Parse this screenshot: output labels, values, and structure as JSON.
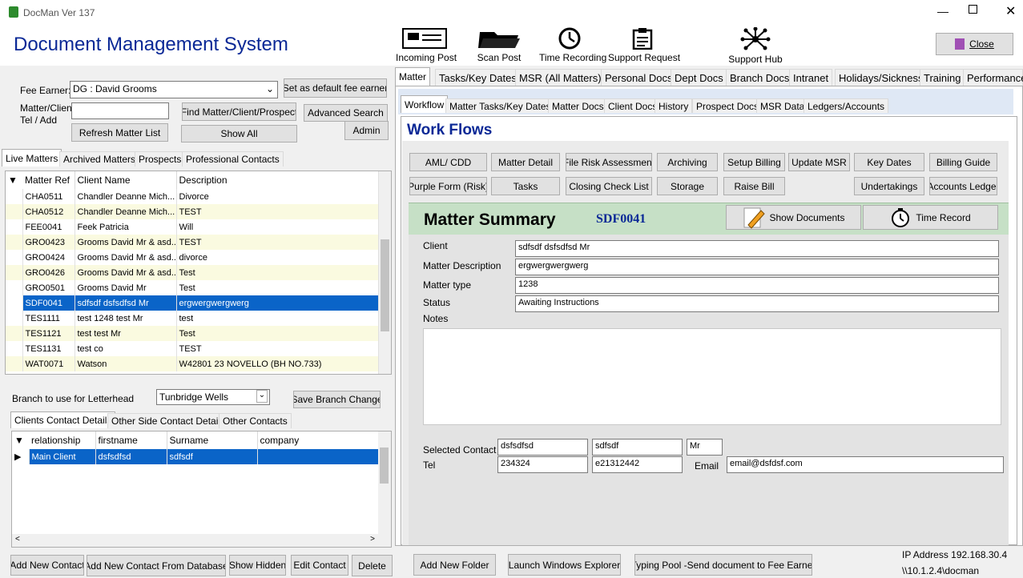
{
  "window": {
    "title": "DocMan Ver 137",
    "app_heading": "Document Management System",
    "close_label": "Close"
  },
  "toolbar": [
    {
      "label": "Incoming Post",
      "icon": "incoming-post-icon"
    },
    {
      "label": "Scan Post",
      "icon": "scan-post-icon"
    },
    {
      "label": "Time Recording",
      "icon": "clock-icon"
    },
    {
      "label": "Support Request",
      "icon": "clipboard-icon"
    },
    {
      "label": "Support Hub",
      "icon": "network-hub-icon"
    }
  ],
  "left": {
    "fee_earner_label": "Fee Earner:",
    "fee_earner_value": "DG : David Grooms",
    "set_default_label": "Set as default fee earner",
    "matter_client_label": "Matter/Client",
    "tel_add_label": "Tel / Add",
    "find_label": "Find Matter/Client/Prospect",
    "advanced_search_label": "Advanced Search",
    "refresh_label": "Refresh Matter List",
    "show_all_label": "Show All",
    "admin_label": "Admin",
    "tabs": [
      "Live Matters",
      "Archived Matters",
      "Prospects",
      "Professional Contacts"
    ],
    "columns": [
      "Matter Ref",
      "Client Name",
      "Description"
    ],
    "rows": [
      [
        "CHA0511",
        "Chandler Deanne Mich...",
        "Divorce"
      ],
      [
        "CHA0512",
        "Chandler Deanne Mich...",
        "TEST"
      ],
      [
        "FEE0041",
        "Feek Patricia",
        "Will"
      ],
      [
        "GRO0423",
        "Grooms David Mr & asd...",
        "TEST"
      ],
      [
        "GRO0424",
        "Grooms David Mr & asd...",
        "divorce"
      ],
      [
        "GRO0426",
        "Grooms David Mr & asd...",
        "Test"
      ],
      [
        "GRO0501",
        "Grooms David Mr",
        "Test"
      ],
      [
        "SDF0041",
        "sdfsdf dsfsdfsd  Mr",
        "ergwergwergwerg"
      ],
      [
        "TES1111",
        "test 1248 test  Mr",
        "test"
      ],
      [
        "TES1121",
        "test test Mr",
        "Test"
      ],
      [
        "TES1131",
        "test co",
        "TEST"
      ],
      [
        "WAT0071",
        "Watson",
        "W42801 23 NOVELLO (BH NO.733)"
      ]
    ],
    "branch_label": "Branch to use for Letterhead",
    "branch_value": "Tunbridge Wells",
    "save_branch_label": "Save Branch Change",
    "contact_tabs": [
      "Clients Contact Details",
      "Other Side Contact Details",
      "Other Contacts"
    ],
    "contact_columns": [
      "relationship",
      "firstname",
      "Surname",
      "company"
    ],
    "contact_rows": [
      [
        "Main Client",
        "dsfsdfsd",
        "sdfsdf",
        ""
      ]
    ],
    "bottom_buttons": [
      "Add New Contact",
      "Add New Contact From Database",
      "Show Hidden",
      "Edit Contact",
      "Delete"
    ]
  },
  "right": {
    "top_tabs": [
      "Matter",
      "Tasks/Key Dates",
      "MSR (All Matters)",
      "Personal Docs",
      "Dept Docs",
      "Branch Docs",
      "Intranet",
      "Holidays/Sickness",
      "Training",
      "Performance"
    ],
    "sub_tabs": [
      "Workflow",
      "Matter Tasks/Key Dates",
      "Matter Docs",
      "Client Docs",
      "History",
      "Prospect Docs",
      "MSR Data",
      "Ledgers/Accounts"
    ],
    "workflows_title": "Work Flows",
    "workflow_buttons_row1": [
      "AML/ CDD",
      "Matter Detail",
      "File Risk Assessment",
      "Archiving",
      "Setup Billing",
      "Update MSR",
      "Key Dates",
      "Billing Guide"
    ],
    "workflow_buttons_row2": [
      "Purple Form (Risk)",
      "Tasks",
      "Closing Check List",
      "Storage",
      "Raise Bill",
      "Undertakings",
      "Accounts Ledger"
    ],
    "summary_title": "Matter Summary",
    "matter_code": "SDF0041",
    "show_documents_label": "Show Documents",
    "time_record_label": "Time Record",
    "client_label": "Client",
    "client_value": "sdfsdf dsfsdfsd  Mr",
    "desc_label": "Matter Description",
    "desc_value": "ergwergwergwerg",
    "type_label": "Matter type",
    "type_value": "1238",
    "status_label": "Status",
    "status_value": "Awaiting Instructions",
    "notes_label": "Notes",
    "selected_contact_label": "Selected Contact",
    "contact_first": "dsfsdfsd",
    "contact_last": "sdfsdf",
    "contact_title": "Mr",
    "tel_label": "Tel",
    "tel1": "234324",
    "tel2": "e21312442",
    "email_label": "Email",
    "email_value": "email@dsfdsf.com",
    "bottom_buttons": [
      "Add New Folder",
      "Launch Windows Explorer",
      "Typing Pool -Send document to Fee Earner"
    ],
    "ip_label": "IP Address 192.168.30.4",
    "path_label": "\\\\10.1.2.4\\docman"
  },
  "colors": {
    "selection": "#0a64c8",
    "heading_blue": "#0a2896",
    "summary_green": "#c6e0c6",
    "workflow_bg": "#dfe8f5"
  }
}
